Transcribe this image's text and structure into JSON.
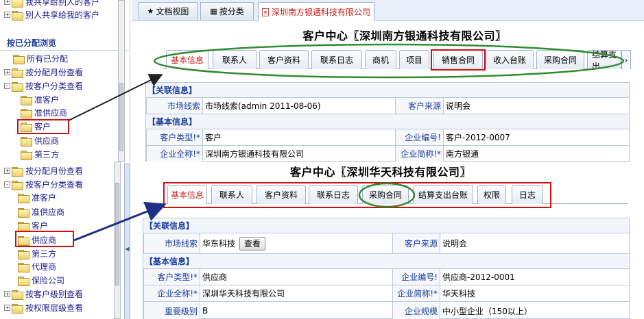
{
  "tree_top": {
    "items_before": [
      {
        "label": "我共享给别人的客户",
        "expand": "+"
      },
      {
        "label": "别人共享给我的客户",
        "expand": "+"
      }
    ],
    "section": "按已分配浏览",
    "items": [
      {
        "label": "所有已分配"
      },
      {
        "label": "按分配月份查看",
        "expand": "+"
      },
      {
        "label": "按客户分类查看",
        "expand": "-"
      },
      {
        "label": "准客户"
      },
      {
        "label": "准供应商"
      },
      {
        "label": "客户"
      },
      {
        "label": "供应商"
      },
      {
        "label": "第三方"
      }
    ]
  },
  "tree_bottom": {
    "items": [
      {
        "label": "按分配月份查看",
        "expand": "+"
      },
      {
        "label": "按客户分类查看",
        "expand": "-"
      },
      {
        "label": "准客户"
      },
      {
        "label": "准供应商"
      },
      {
        "label": "客户"
      },
      {
        "label": "供应商"
      },
      {
        "label": "第三方"
      },
      {
        "label": "代理商"
      },
      {
        "label": "保险公司"
      },
      {
        "label": "按客户级别查看",
        "expand": "+"
      },
      {
        "label": "按权限层级查看",
        "expand": "+"
      }
    ]
  },
  "doc_tabs": [
    {
      "label": "文档视图",
      "icon": "star-icon"
    },
    {
      "label": "按分类",
      "icon": "grid-icon"
    },
    {
      "label": "深圳南方银通科技有限公司",
      "icon": "document-icon"
    }
  ],
  "panel_top": {
    "title": "客户中心〖深圳南方银通科技有限公司〗",
    "tabs": [
      "基本信息",
      "联系人",
      "客户资料",
      "联系日志",
      "商机",
      "项目",
      "销售合同",
      "收入台账",
      "采购合同",
      "结算支出"
    ],
    "tab_scroll_icon": "›",
    "band_related": "【关联信息】",
    "band_basic": "【基本信息】",
    "rows": [
      {
        "l1": "市场线索",
        "v1": "市场线索(admin 2011-08-06)",
        "l2": "客户来源",
        "v2": "说明会"
      },
      {
        "l1": "客户类型!*",
        "v1": "客户",
        "l2": "企业编号!",
        "v2": "客户-2012-0007"
      },
      {
        "l1": "企业全称!*",
        "v1": "深圳南方银通科技有限公司",
        "l2": "企业简称!*",
        "v2": "南方银通"
      }
    ]
  },
  "panel_bottom": {
    "title": "客户中心〖深圳华天科技有限公司〗",
    "tabs": [
      "基本信息",
      "联系人",
      "客户资料",
      "联系日志",
      "采购合同",
      "结算支出台账",
      "权限",
      "日志"
    ],
    "band_related": "【关联信息】",
    "band_basic": "【基本信息】",
    "view_button": "查看",
    "rows": [
      {
        "l1": "市场线索",
        "v1": "华东科技",
        "l2": "客户来源",
        "v2": "说明会"
      },
      {
        "l1": "客户类型!*",
        "v1": "供应商",
        "l2": "企业编号!",
        "v2": "供应商-2012-0001"
      },
      {
        "l1": "企业全称!*",
        "v1": "深圳华天科技有限公司",
        "l2": "企业简称!*",
        "v2": "华天科技"
      },
      {
        "l1": "重要级别",
        "v1": "B",
        "l2": "企业规模",
        "v2": "中小型企业（150以上）"
      }
    ]
  },
  "colors": {
    "highlight_red": "#d21010",
    "highlight_green": "#2e8b2e",
    "arrow_black": "#222222",
    "arrow_navy": "#1f2e86"
  }
}
